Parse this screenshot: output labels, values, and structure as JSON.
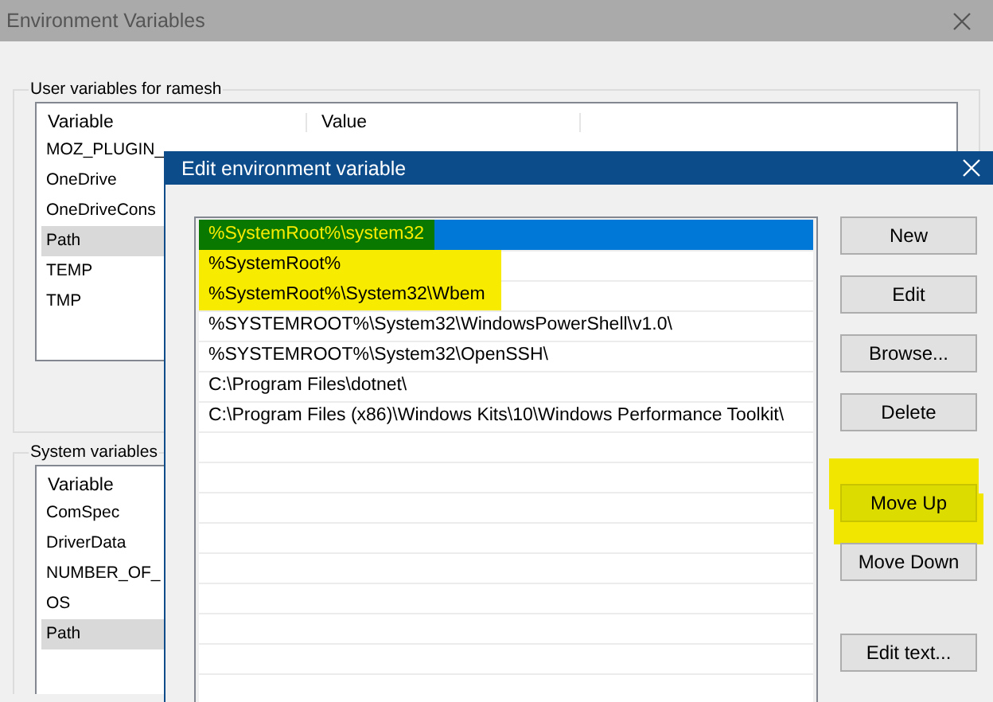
{
  "background_window": {
    "title": "Environment Variables",
    "user_variables": {
      "label": "User variables for ramesh",
      "columns": [
        "Variable",
        "Value"
      ],
      "rows": [
        {
          "name": "MOZ_PLUGIN_",
          "selected": false
        },
        {
          "name": "OneDrive",
          "selected": false
        },
        {
          "name": "OneDriveCons",
          "selected": false
        },
        {
          "name": "Path",
          "selected": true
        },
        {
          "name": "TEMP",
          "selected": false
        },
        {
          "name": "TMP",
          "selected": false
        }
      ]
    },
    "system_variables": {
      "label": "System variables",
      "columns": [
        "Variable"
      ],
      "rows": [
        {
          "name": "ComSpec",
          "selected": false
        },
        {
          "name": "DriverData",
          "selected": false
        },
        {
          "name": "NUMBER_OF_",
          "selected": false
        },
        {
          "name": "OS",
          "selected": false
        },
        {
          "name": "Path",
          "selected": true
        }
      ]
    }
  },
  "dialog": {
    "title": "Edit environment variable",
    "entries": [
      {
        "text": "%SystemRoot%\\system32",
        "selected": true,
        "highlighted": true
      },
      {
        "text": "%SystemRoot%",
        "selected": false,
        "highlighted": true
      },
      {
        "text": "%SystemRoot%\\System32\\Wbem",
        "selected": false,
        "highlighted": true
      },
      {
        "text": "%SYSTEMROOT%\\System32\\WindowsPowerShell\\v1.0\\",
        "selected": false,
        "highlighted": false
      },
      {
        "text": "%SYSTEMROOT%\\System32\\OpenSSH\\",
        "selected": false,
        "highlighted": false
      },
      {
        "text": "C:\\Program Files\\dotnet\\",
        "selected": false,
        "highlighted": false
      },
      {
        "text": "C:\\Program Files (x86)\\Windows Kits\\10\\Windows Performance Toolkit\\",
        "selected": false,
        "highlighted": false
      }
    ],
    "button_groups": [
      [
        {
          "label": "New",
          "highlighted": false
        },
        {
          "label": "Edit",
          "highlighted": false
        },
        {
          "label": "Browse...",
          "highlighted": false
        },
        {
          "label": "Delete",
          "highlighted": false
        }
      ],
      [
        {
          "label": "Move Up",
          "highlighted": true
        },
        {
          "label": "Move Down",
          "highlighted": false
        }
      ],
      [
        {
          "label": "Edit text...",
          "highlighted": false
        }
      ]
    ]
  }
}
